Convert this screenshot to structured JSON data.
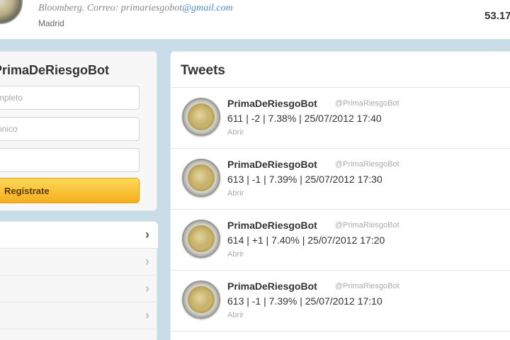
{
  "header": {
    "bio_text": "Bloomberg. Correo: primariesgobot",
    "bio_email_domain": "@gmail.com",
    "location": "Madrid",
    "stat_value": "53.17"
  },
  "signup": {
    "title": "PrimaDeRiesgoBot",
    "name_placeholder": "mpleto",
    "email_placeholder": "ónico",
    "password_placeholder": "",
    "button_label": "Regístrate"
  },
  "sidebar": {
    "chevron": "›"
  },
  "timeline": {
    "title": "Tweets",
    "tweets": [
      {
        "name": "PrimaDeRiesgoBot",
        "handle": "@PrimaRiesgoBot",
        "text": "611 | -2 | 7.38% | 25/07/2012 17:40",
        "action": "Abrir"
      },
      {
        "name": "PrimaDeRiesgoBot",
        "handle": "@PrimaRiesgoBot",
        "text": "613 | -1 | 7.39% | 25/07/2012 17:30",
        "action": "Abrir"
      },
      {
        "name": "PrimaDeRiesgoBot",
        "handle": "@PrimaRiesgoBot",
        "text": "614 | +1 | 7.40% | 25/07/2012 17:20",
        "action": "Abrir"
      },
      {
        "name": "PrimaDeRiesgoBot",
        "handle": "@PrimaRiesgoBot",
        "text": "613 | -1 | 7.39% | 25/07/2012 17:10",
        "action": "Abrir"
      }
    ]
  }
}
